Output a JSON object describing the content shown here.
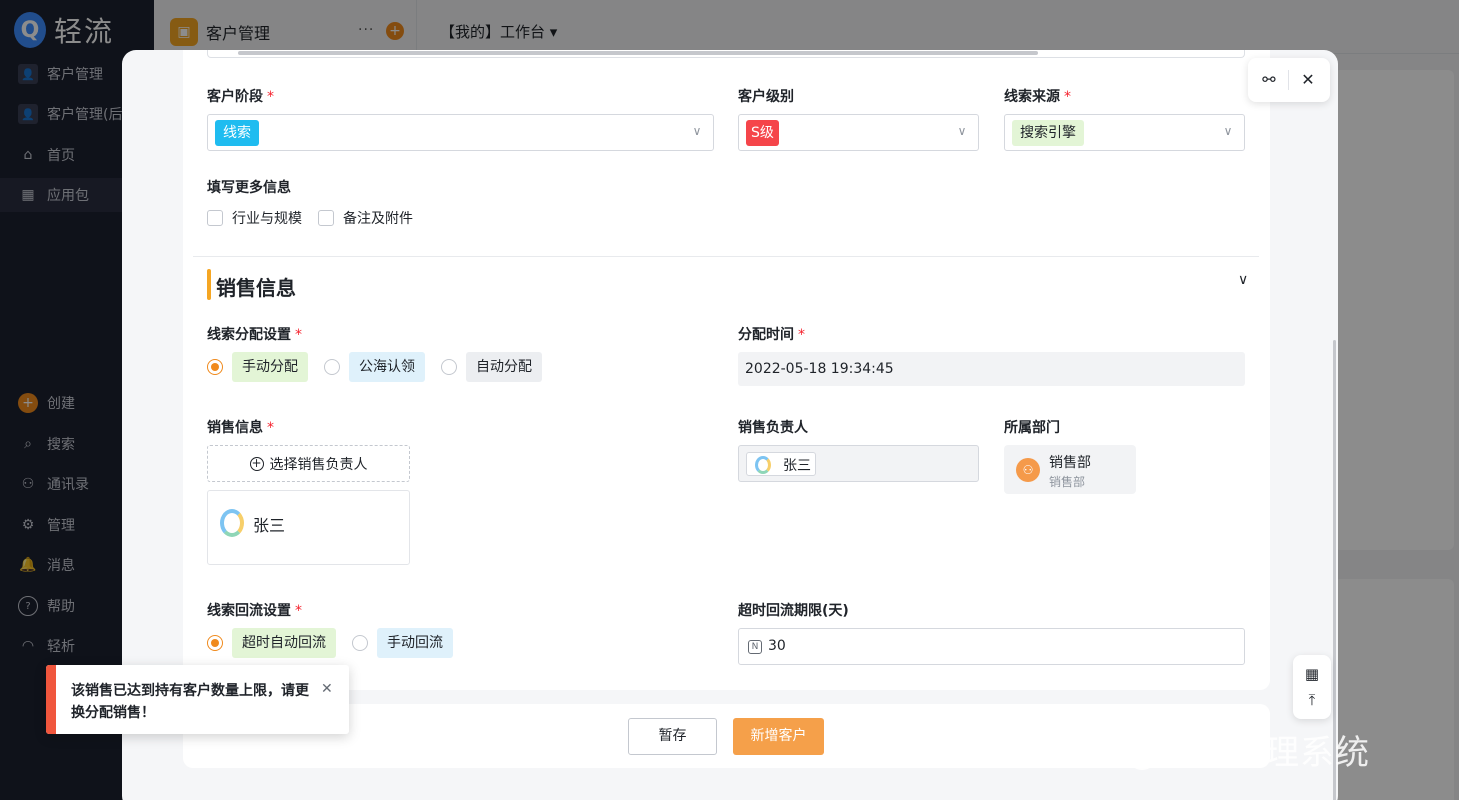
{
  "brand": {
    "name": "轻流",
    "logo_letter": "Q"
  },
  "sidebar": {
    "items": [
      {
        "label": "客户管理",
        "icon": "user-box-icon"
      },
      {
        "label": "客户管理(后",
        "icon": "user-box-icon"
      },
      {
        "label": "首页",
        "icon": "home-icon"
      },
      {
        "label": "应用包",
        "icon": "grid-icon"
      }
    ],
    "lower_items": [
      {
        "label": "创建",
        "icon": "plus-circle-icon"
      },
      {
        "label": "搜索",
        "icon": "search-icon"
      },
      {
        "label": "通讯录",
        "icon": "contacts-icon"
      },
      {
        "label": "管理",
        "icon": "gear-icon"
      },
      {
        "label": "消息",
        "icon": "bell-icon"
      },
      {
        "label": "帮助",
        "icon": "help-icon"
      },
      {
        "label": "轻析",
        "icon": "analytics-icon"
      }
    ]
  },
  "topbar": {
    "app_title": "客户管理",
    "more": "···",
    "workbench": "【我的】工作台 ▾"
  },
  "form": {
    "customer_stage": {
      "label": "客户阶段",
      "value": "线索",
      "tag_color": "#1fbcf0"
    },
    "customer_level": {
      "label": "客户级别",
      "value": "S级",
      "tag_color": "#f5454a"
    },
    "lead_source": {
      "label": "线索来源",
      "value": "搜索引擎",
      "tag_color": "#e3f5d6"
    },
    "more_info": {
      "label": "填写更多信息",
      "options": [
        "行业与规模",
        "备注及附件"
      ]
    },
    "sales_section_title": "销售信息",
    "lead_assignment": {
      "label": "线索分配设置",
      "options": [
        "手动分配",
        "公海认领",
        "自动分配"
      ],
      "selected": "手动分配"
    },
    "assign_time": {
      "label": "分配时间",
      "value": "2022-05-18 19:34:45"
    },
    "sales_info": {
      "label": "销售信息",
      "select_button": "选择销售负责人",
      "person": "张三"
    },
    "sales_owner": {
      "label": "销售负责人",
      "value": "张三"
    },
    "department": {
      "label": "所属部门",
      "name": "销售部",
      "sub": "销售部"
    },
    "lead_return": {
      "label": "线索回流设置",
      "options": [
        "超时自动回流",
        "手动回流"
      ],
      "selected": "超时自动回流"
    },
    "timeout_days": {
      "label": "超时回流期限(天)",
      "value": "30",
      "icon_letter": "N"
    }
  },
  "required_mark": "*",
  "footer": {
    "save_label": "暂存",
    "add_label": "新增客户"
  },
  "toast": {
    "message": "该销售已达到持有客户数量上限，请更换分配销售！"
  },
  "watermark": "@轻流管理系统",
  "colors": {
    "accent": "#f08a1d",
    "primary_button": "#f5a04a",
    "toast_bar": "#f0563d"
  }
}
